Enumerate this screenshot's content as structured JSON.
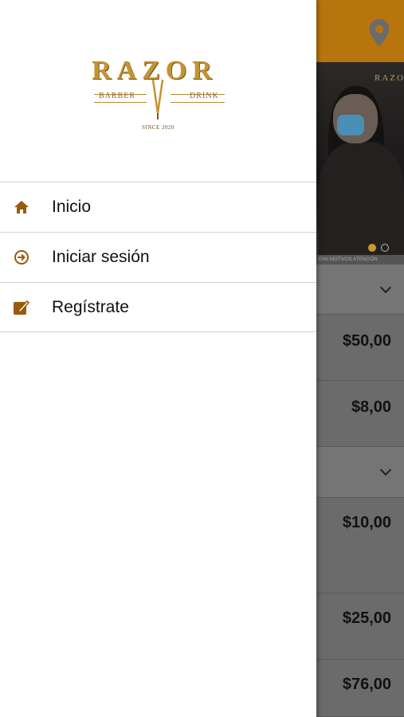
{
  "background": {
    "banner_mini_logo": "RAZOR",
    "caption_strip": "EAN MOTIVOS ATENCIÓN",
    "prices": [
      "$50,00",
      "$8,00",
      "$10,00",
      "$25,00",
      "$76,00"
    ]
  },
  "logo": {
    "word": "RAZOR",
    "left_text": "BARBER",
    "right_text": "DRINK",
    "since": "SINCE 2020"
  },
  "menu": {
    "items": [
      {
        "label": "Inicio",
        "icon": "home-icon"
      },
      {
        "label": "Iniciar sesión",
        "icon": "login-icon"
      },
      {
        "label": "Regístrate",
        "icon": "register-icon"
      }
    ]
  },
  "colors": {
    "accent": "#b8750d",
    "logo_gold": "#c29433",
    "icon_brown": "#9a5a0a"
  }
}
